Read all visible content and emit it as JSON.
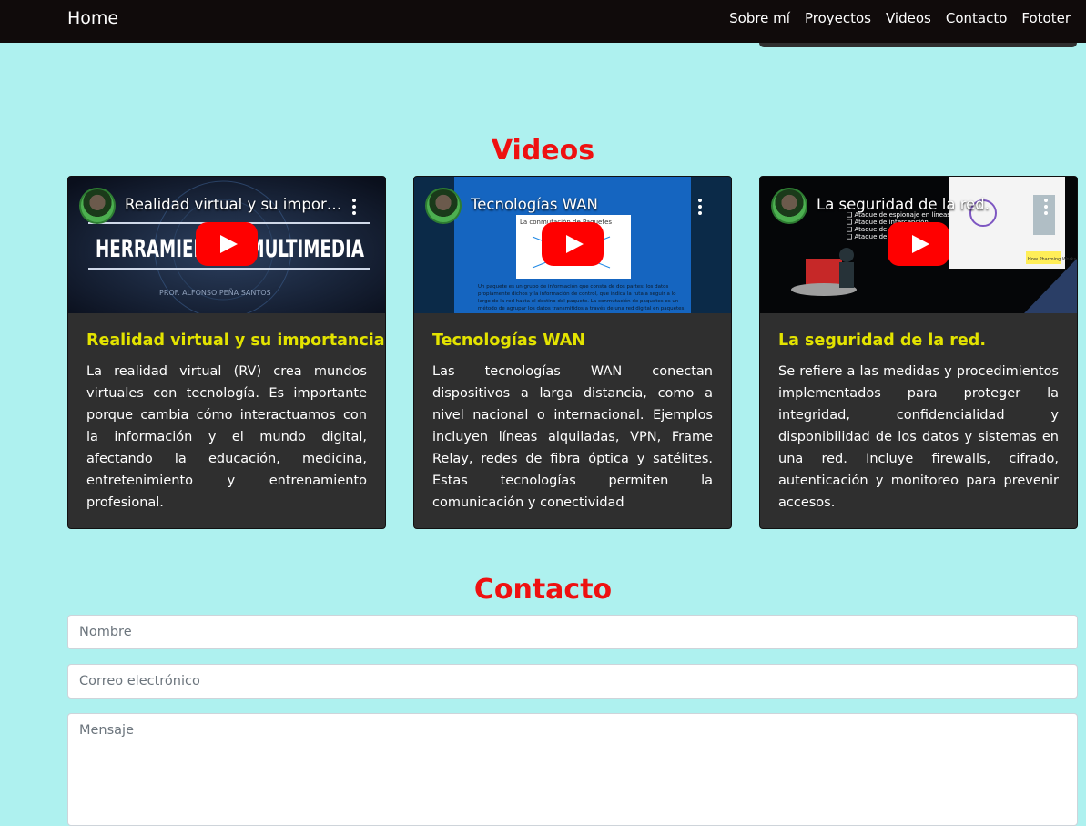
{
  "nav": {
    "brand": "Home",
    "links": [
      "Sobre mí",
      "Proyectos",
      "Videos",
      "Contacto",
      "Fototer"
    ]
  },
  "videos_section": {
    "title": "Videos",
    "cards": [
      {
        "video_title": "Realidad virtual y su impor…",
        "thumb_text": "HERRAMIENTAS MULTIMEDIA",
        "title": "Realidad virtual y su importancia.",
        "text": "La realidad virtual (RV) crea mundos virtuales con tecnología. Es importante porque cambia cómo interactuamos con la información y el mundo digital, afectando la educación, medicina, entretenimiento y entrenamiento profesional."
      },
      {
        "video_title": "Tecnologías WAN",
        "thumb_text": "La conmutación de Paquetes",
        "title": "Tecnologías WAN",
        "text": "Las tecnologías WAN conectan dispositivos a larga distancia, como a nivel nacional o internacional. Ejemplos incluyen líneas alquiladas, VPN, Frame Relay, redes de fibra óptica y satélites. Estas tecnologías permiten la comunicación y conectividad"
      },
      {
        "video_title": "La seguridad de la red.",
        "thumb_text": "How Pharming Works",
        "title": "La seguridad de la red.",
        "text": "Se refiere a las medidas y procedimientos implementados para proteger la integridad, confidencialidad y disponibilidad de los datos y sistemas en una red. Incluye firewalls, cifrado, autenticación y monitoreo para prevenir accesos."
      }
    ]
  },
  "contact_section": {
    "title": "Contacto",
    "name_placeholder": "Nombre",
    "email_placeholder": "Correo electrónico",
    "message_placeholder": "Mensaje"
  },
  "colors": {
    "background": "#aef1ef",
    "navbar": "#100b0b",
    "section_title": "#ee1111",
    "card_background": "#2f2f2f",
    "card_title": "#e3e300"
  }
}
